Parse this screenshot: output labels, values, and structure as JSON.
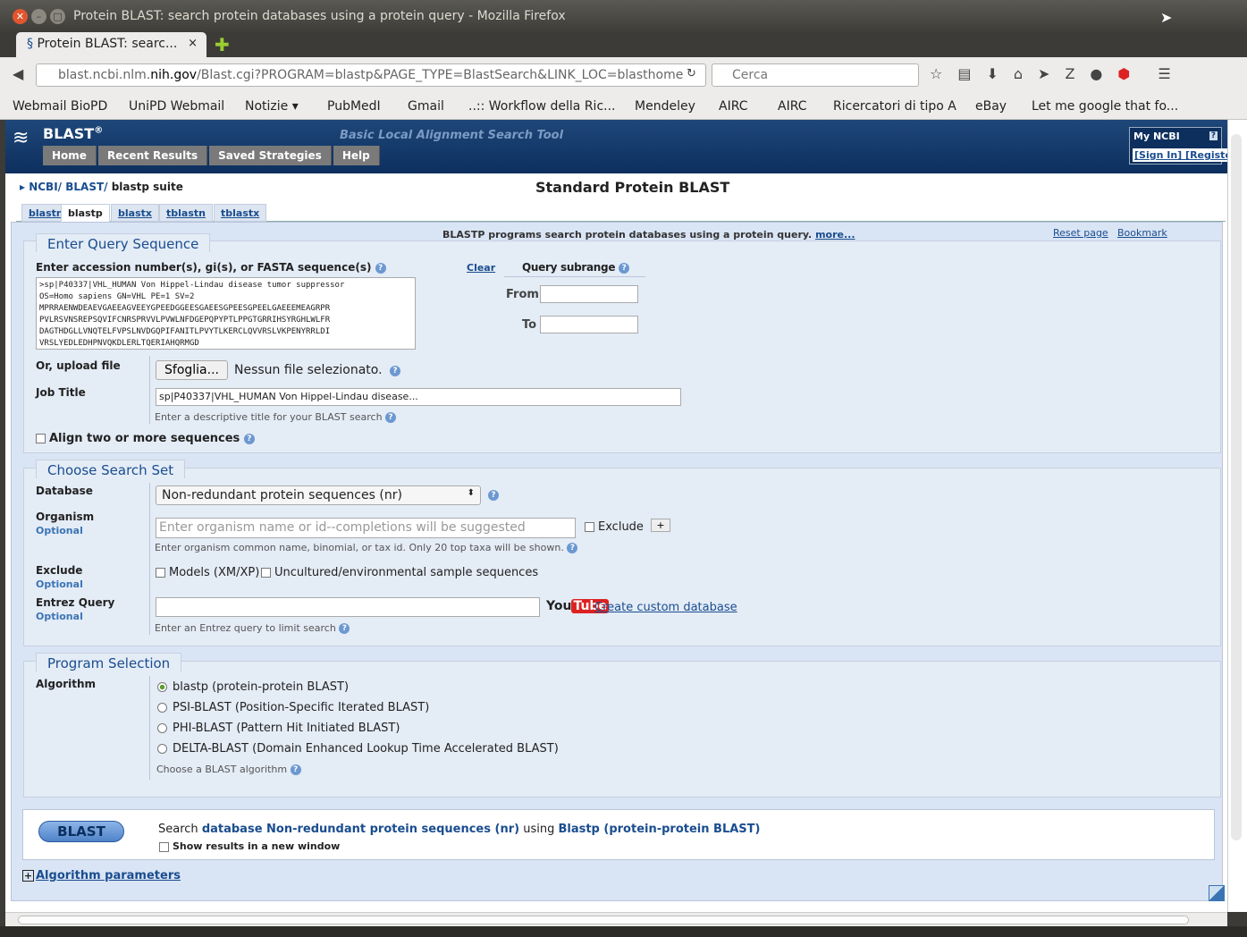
{
  "window": {
    "title": "Protein BLAST: search protein databases using a protein query - Mozilla Firefox"
  },
  "tab": {
    "label": "Protein BLAST: searc...",
    "close": "×"
  },
  "newtab": "✚",
  "url": {
    "host_pre": "blast.ncbi.nlm.",
    "host_main": "nih.gov",
    "path": "/Blast.cgi?PROGRAM=blastp&PAGE_TYPE=BlastSearch&LINK_LOC=blasthome"
  },
  "search": {
    "placeholder": "Cerca"
  },
  "bookmarks": [
    "Webmail BioPD",
    "UniPD Webmail",
    "Notizie ▾",
    "PubMedI",
    "Gmail",
    "..:: Workflow della Ric...",
    "Mendeley",
    "AIRC",
    "AIRC",
    "Ricercatori di tipo A",
    "eBay",
    "Let me google that fo..."
  ],
  "blast": {
    "name": "BLAST",
    "reg": "®",
    "subtitle": "Basic Local Alignment Search Tool",
    "nav": [
      "Home",
      "Recent Results",
      "Saved Strategies",
      "Help"
    ],
    "myncbi": {
      "title": "My NCBI",
      "help": "?",
      "links": "[Sign In] [Register]"
    },
    "breadcrumb": {
      "ncbi": "NCBI",
      "blast": "BLAST",
      "current": "blastp suite"
    },
    "page_title": "Standard Protein BLAST",
    "program_tabs": [
      "blastn",
      "blastp",
      "blastx",
      "tblastn",
      "tblastx"
    ],
    "info": "BLASTP programs search protein databases using a protein query.",
    "more": "more...",
    "reset": "Reset page",
    "bookmark": "Bookmark"
  },
  "query": {
    "legend": "Enter Query Sequence",
    "label": "Enter accession number(s), gi(s), or FASTA sequence(s)",
    "clear": "Clear",
    "subrange": "Query subrange",
    "from": "From",
    "to": "To",
    "sequence": ">sp|P40337|VHL_HUMAN Von Hippel-Lindau disease tumor suppressor\nOS=Homo sapiens GN=VHL PE=1 SV=2\nMPRRAENWDEAEVGAEEAGVEEYGPEEDGGEESGAEESGPEESGPEELGAEEEMEAGRPR\nPVLRSVNSREPSQVIFCNRSPRVVLPVWLNFDGEPQPYPTLPPGTGRRIHSYRGHLWLFR\nDAGTHDGLLVNQTELFVPSLNVDGQPIFANITLPVYTLKERCLQVVRSLVKPENYRRLDI\nVRSLYEDLEDHPNVQKDLERLTQERIAHQRMGD",
    "upload_label": "Or, upload file",
    "browse": "Sfoglia...",
    "no_file": "Nessun file selezionato.",
    "job_label": "Job Title",
    "job_value": "sp|P40337|VHL_HUMAN Von Hippel-Lindau disease...",
    "job_hint": "Enter a descriptive title for your BLAST search",
    "align_label": "Align two or more sequences"
  },
  "searchset": {
    "legend": "Choose Search Set",
    "db_label": "Database",
    "db_value": "Non-redundant protein sequences (nr)",
    "org_label": "Organism",
    "optional": "Optional",
    "org_placeholder": "Enter organism name or id--completions will be suggested",
    "exclude": "Exclude",
    "plus": "+",
    "org_hint": "Enter organism common name, binomial, or tax id. Only 20 top taxa will be shown.",
    "excl_label": "Exclude",
    "models": "Models (XM/XP)",
    "uncultured": "Uncultured/environmental sample sequences",
    "entrez_label": "Entrez Query",
    "youtube_you": "You",
    "youtube_tube": "Tube",
    "custom_db": "Create custom database",
    "entrez_hint": "Enter an Entrez query to limit search"
  },
  "program": {
    "legend": "Program Selection",
    "algo_label": "Algorithm",
    "options": [
      "blastp (protein-protein BLAST)",
      "PSI-BLAST (Position-Specific Iterated BLAST)",
      "PHI-BLAST (Pattern Hit Initiated BLAST)",
      "DELTA-BLAST (Domain Enhanced Lookup Time Accelerated BLAST)"
    ],
    "hint": "Choose a BLAST algorithm"
  },
  "submit": {
    "button": "BLAST",
    "search_word": "Search",
    "db_text": "database Non-redundant protein sequences (nr)",
    "using": "using",
    "prog_text": "Blastp (protein-protein BLAST)",
    "new_window": "Show results in a new window",
    "algo_params": "Algorithm parameters"
  }
}
